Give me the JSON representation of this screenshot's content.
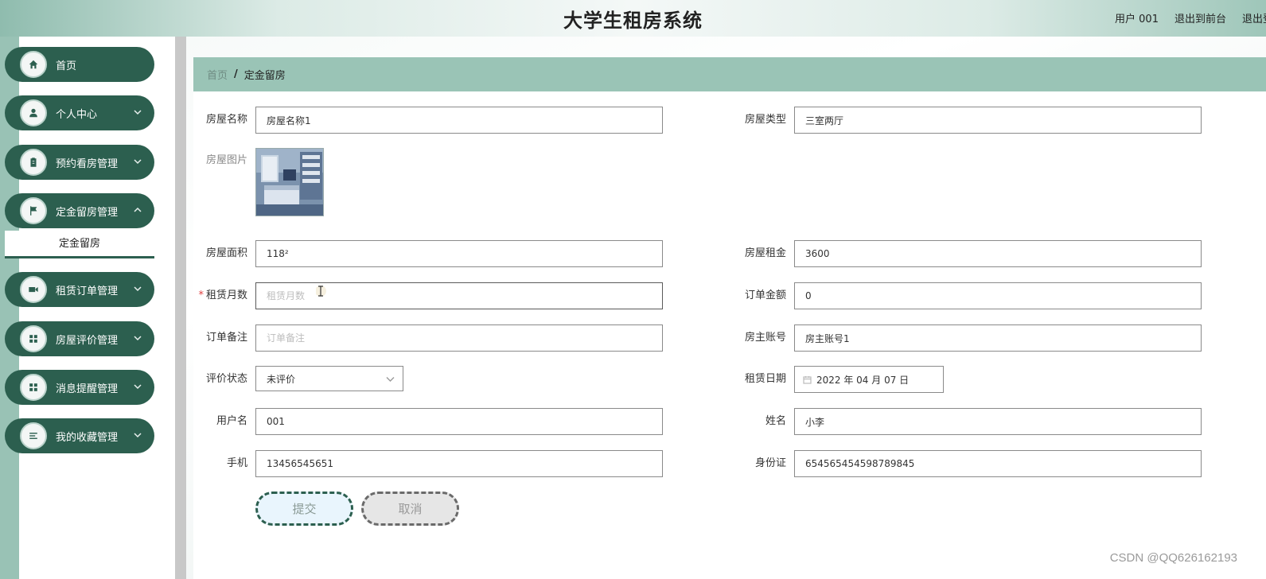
{
  "header": {
    "title": "大学生租房系统",
    "user_label": "用户 001",
    "exit_front_label": "退出到前台",
    "logout_label": "退出登录"
  },
  "sidebar": {
    "items": [
      {
        "label": "首页",
        "icon": "home-icon"
      },
      {
        "label": "个人中心",
        "icon": "user-icon"
      },
      {
        "label": "预约看房管理",
        "icon": "clipboard-icon"
      },
      {
        "label": "定金留房管理",
        "icon": "flag-icon"
      },
      {
        "label": "租赁订单管理",
        "icon": "video-icon"
      },
      {
        "label": "房屋评价管理",
        "icon": "grid-icon"
      },
      {
        "label": "消息提醒管理",
        "icon": "grid-icon"
      },
      {
        "label": "我的收藏管理",
        "icon": "list-icon"
      }
    ],
    "submenu": {
      "label": "定金留房"
    }
  },
  "breadcrumb": {
    "home": "首页",
    "separator": "/",
    "current": "定金留房"
  },
  "form": {
    "house_name": {
      "label": "房屋名称",
      "value": "房屋名称1"
    },
    "house_type": {
      "label": "房屋类型",
      "value": "三室两厅"
    },
    "house_image": {
      "label": "房屋图片"
    },
    "house_area": {
      "label": "房屋面积",
      "value": "118²"
    },
    "house_rent": {
      "label": "房屋租金",
      "value": "3600"
    },
    "rent_months": {
      "label": "租赁月数",
      "placeholder": "租赁月数",
      "required": true
    },
    "order_amount": {
      "label": "订单金额",
      "value": "0"
    },
    "order_note": {
      "label": "订单备注",
      "placeholder": "订单备注"
    },
    "landlord_account": {
      "label": "房主账号",
      "value": "房主账号1"
    },
    "review_status": {
      "label": "评价状态",
      "value": "未评价"
    },
    "rent_date": {
      "label": "租赁日期",
      "value": "2022 年 04 月 07 日"
    },
    "username": {
      "label": "用户名",
      "value": "001"
    },
    "real_name": {
      "label": "姓名",
      "value": "小李"
    },
    "phone": {
      "label": "手机",
      "value": "13456545651"
    },
    "id_card": {
      "label": "身份证",
      "value": "654565454598789845"
    },
    "submit_label": "提交",
    "cancel_label": "取消"
  },
  "watermark": "CSDN @QQ626162193",
  "colors": {
    "sidebar_item": "#2c5f4f",
    "breadcrumb_bar": "#9ac4b6",
    "side_strip": "#99c2b5"
  }
}
